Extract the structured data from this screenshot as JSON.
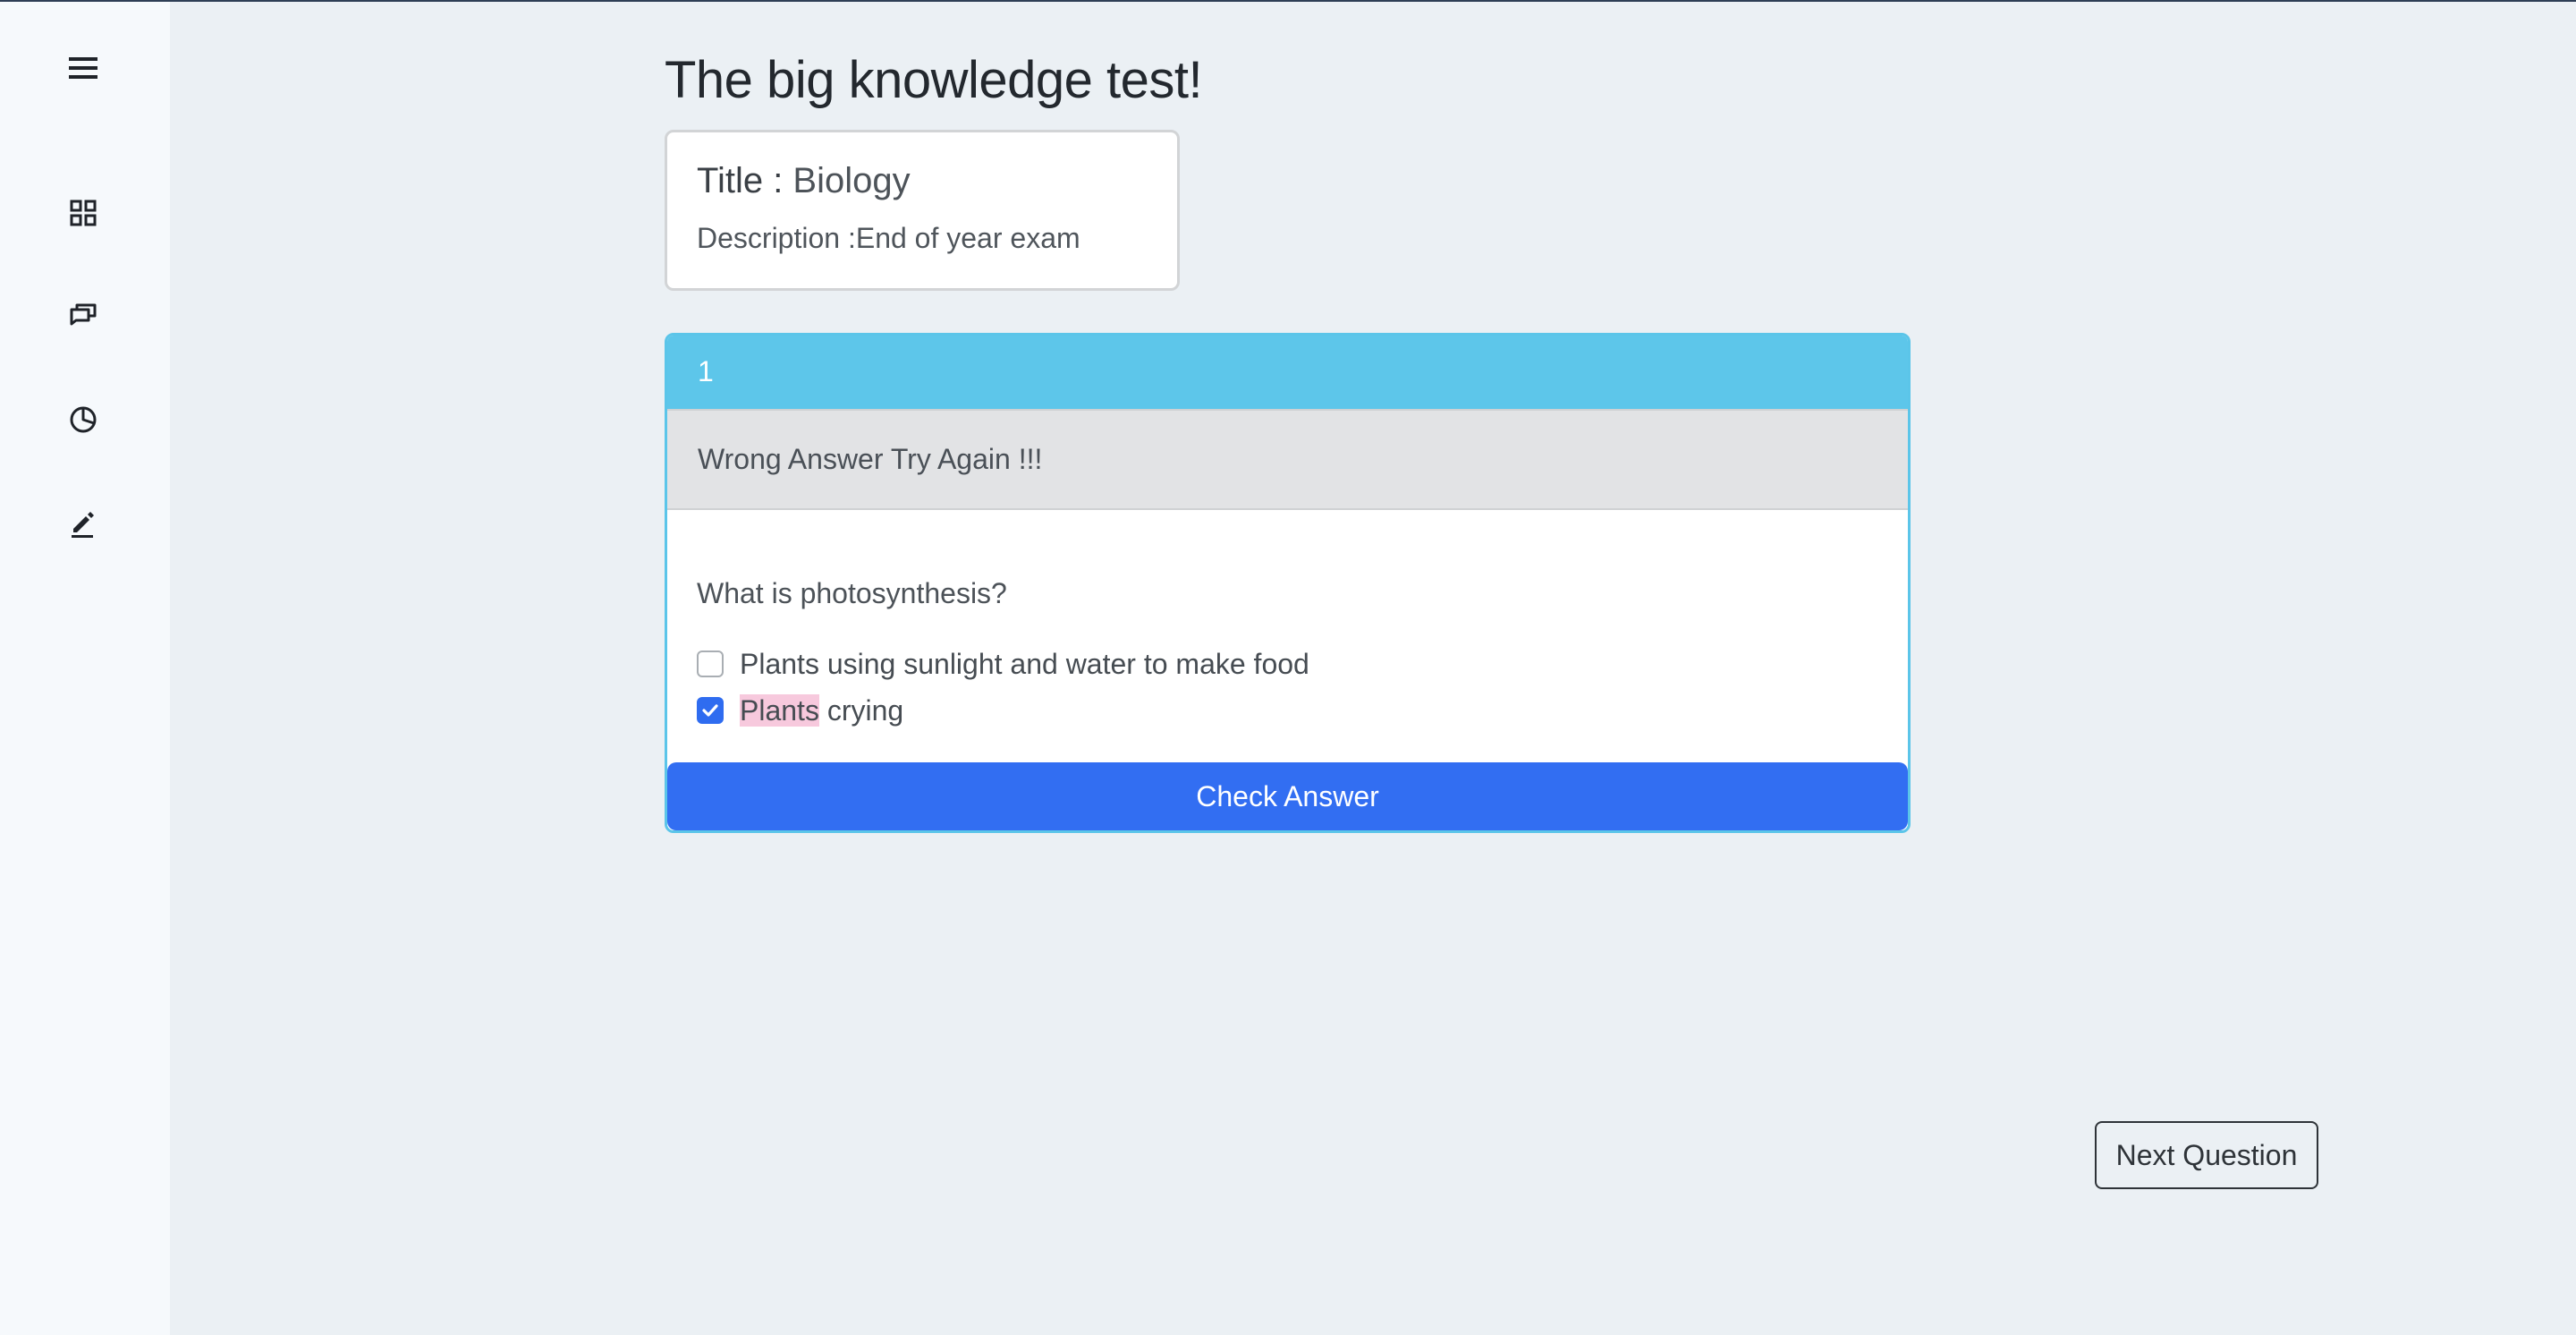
{
  "sidebar": {
    "items": [
      {
        "icon": "menu-icon"
      },
      {
        "icon": "dashboard-icon"
      },
      {
        "icon": "chat-icon"
      },
      {
        "icon": "pie-chart-icon"
      },
      {
        "icon": "edit-icon"
      }
    ]
  },
  "page": {
    "title": "The big knowledge test!"
  },
  "quiz_info": {
    "title_label": "Title : ",
    "title_value": "Biology",
    "description": "Description :End of year exam"
  },
  "question": {
    "number": "1",
    "feedback": "Wrong Answer Try Again !!!",
    "text": "What is photosynthesis?",
    "options": [
      {
        "label": "Plants using sunlight and water to make food",
        "checked": false
      },
      {
        "label_highlight": "Plants",
        "label_rest": " crying",
        "checked": true
      }
    ],
    "check_label": "Check Answer"
  },
  "footer": {
    "next_label": "Next Question"
  },
  "colors": {
    "header": "#5dc6ea",
    "primary": "#326ef2",
    "background": "#ebf0f4",
    "highlight": "#f7c9dd"
  }
}
